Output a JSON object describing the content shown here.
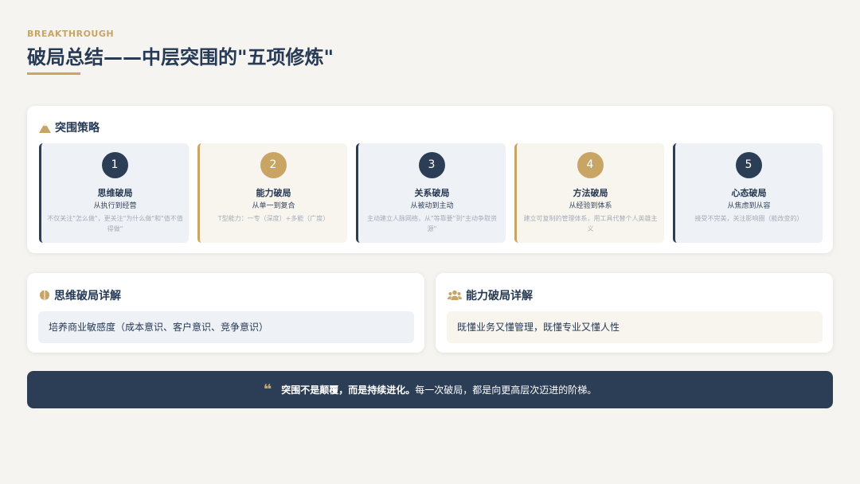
{
  "header": {
    "eyebrow": "BREAKTHROUGH",
    "title": "破局总结——中层突围的\"五项修炼\""
  },
  "strategy": {
    "title": "突围策略",
    "pillars": [
      {
        "number": "1",
        "name": "思维破局",
        "subtitle": "从执行到经营",
        "description": "不仅关注\"怎么做\"，更关注\"为什么做\"和\"值不值得做\"",
        "accent": "#2c3e55"
      },
      {
        "number": "2",
        "name": "能力破局",
        "subtitle": "从单一到复合",
        "description": "T型能力：一专（深度）+多能（广度）",
        "accent": "#c8a565"
      },
      {
        "number": "3",
        "name": "关系破局",
        "subtitle": "从被动到主动",
        "description": "主动建立人脉网络，从\"等靠要\"到\"主动争取资源\"",
        "accent": "#2c3e55"
      },
      {
        "number": "4",
        "name": "方法破局",
        "subtitle": "从经验到体系",
        "description": "建立可复制的管理体系，用工具代替个人英雄主义",
        "accent": "#c8a565"
      },
      {
        "number": "5",
        "name": "心态破局",
        "subtitle": "从焦虑到从容",
        "description": "接受不完美，关注影响圈（能改变的）",
        "accent": "#2c3e55"
      }
    ]
  },
  "details": {
    "thinking": {
      "title": "思维破局详解",
      "content": "培养商业敏感度（成本意识、客户意识、竞争意识）",
      "icon": "brain-icon"
    },
    "ability": {
      "title": "能力破局详解",
      "content": "既懂业务又懂管理，既懂专业又懂人性",
      "icon": "users-icon"
    }
  },
  "quote": {
    "mark": "❝",
    "bold": "突围不是颠覆，而是持续进化。",
    "rest": "每一次破局，都是向更高层次迈进的阶梯。"
  },
  "colors": {
    "navy": "#2c3e55",
    "gold": "#c8a565",
    "background": "#f5f4f0"
  }
}
